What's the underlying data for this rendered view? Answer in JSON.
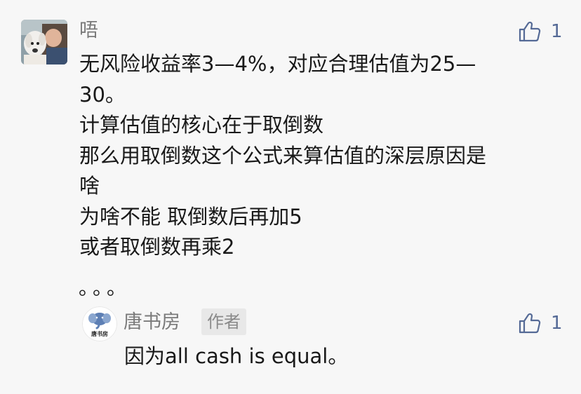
{
  "comment": {
    "username": "唔",
    "like_count": "1",
    "lines": [
      "无风险收益率3—4%，对应合理估值为25—",
      "30。",
      "计算估值的核心在于取倒数",
      "那么用取倒数这个公式来算估值的深层原因是",
      "啥",
      "为啥不能  取倒数后再加5",
      "或者取倒数再乘2"
    ],
    "trailing": "。。。"
  },
  "reply": {
    "avatar_text": "唐书房",
    "name": "唐书房",
    "badge": "作者",
    "like_count": "1",
    "text": "因为all cash is equal。"
  },
  "colors": {
    "background": "#f7f7f7",
    "link_blue": "#556a96",
    "meta_gray": "#7a7a7a",
    "text": "#191919"
  }
}
